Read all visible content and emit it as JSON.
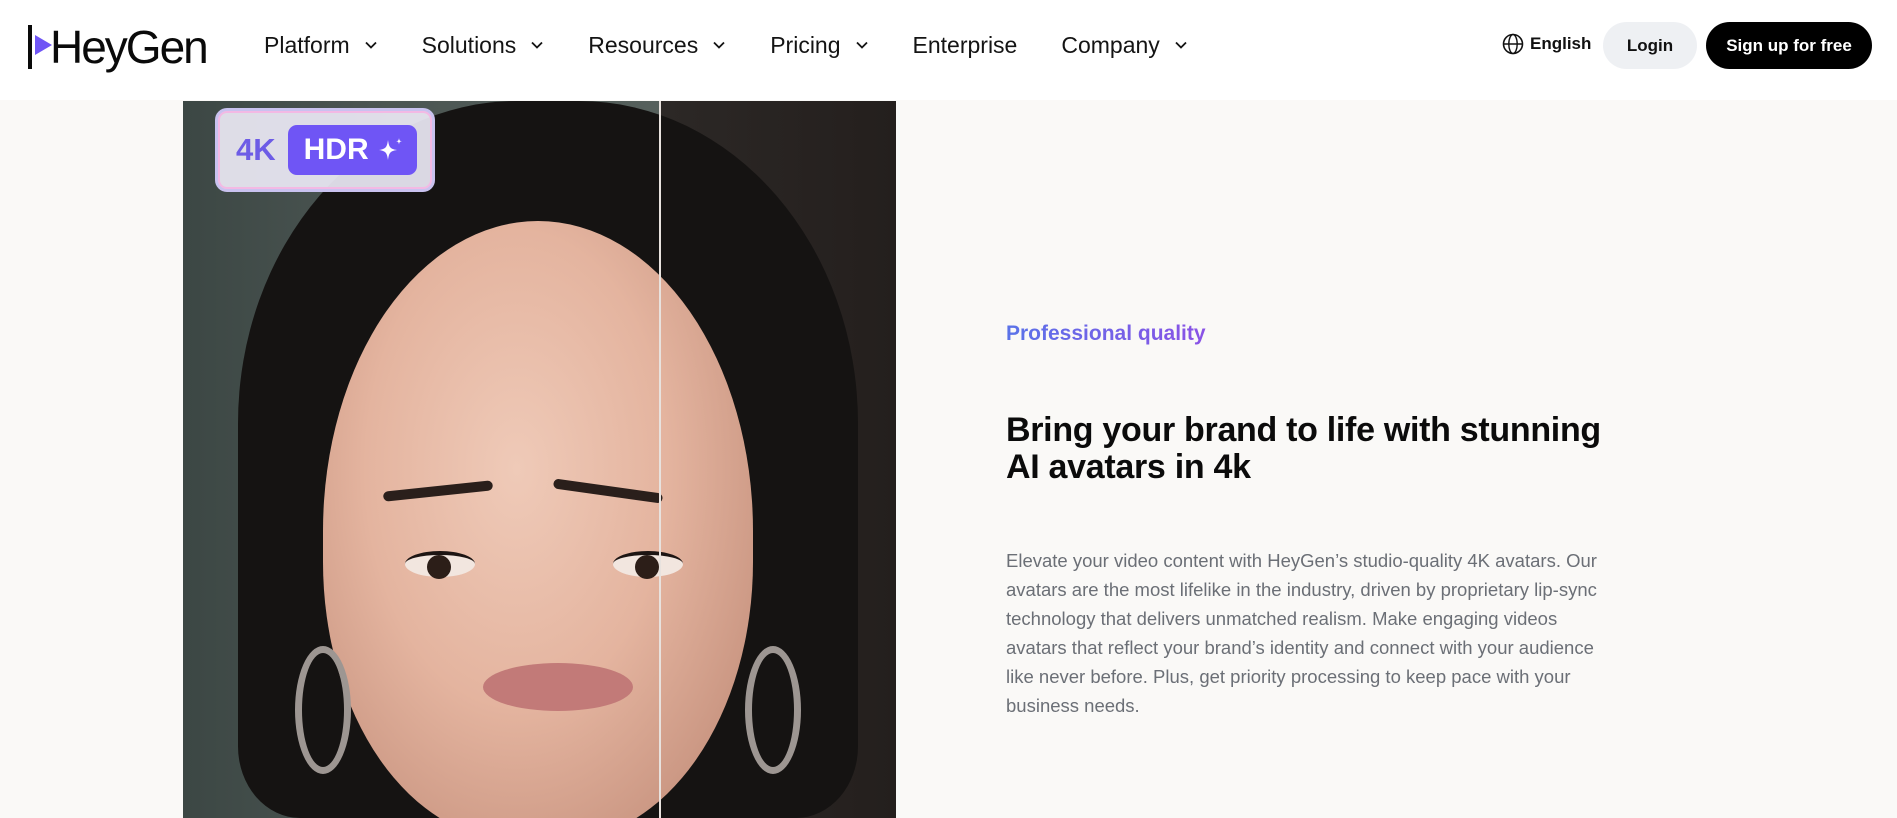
{
  "header": {
    "logo_text": "HeyGen",
    "nav": [
      {
        "label": "Platform",
        "has_dropdown": true
      },
      {
        "label": "Solutions",
        "has_dropdown": true
      },
      {
        "label": "Resources",
        "has_dropdown": true
      },
      {
        "label": "Pricing",
        "has_dropdown": true
      },
      {
        "label": "Enterprise",
        "has_dropdown": false
      },
      {
        "label": "Company",
        "has_dropdown": true
      }
    ],
    "language": "English",
    "login_label": "Login",
    "signup_label": "Sign up for free"
  },
  "hero_image": {
    "badge_resolution": "4K",
    "badge_hdr": "HDR",
    "icons": [
      "sparkle-icon"
    ]
  },
  "section": {
    "eyebrow": "Professional quality",
    "headline": "Bring your brand to life with stunning AI avatars in 4k",
    "body": "Elevate your video content with HeyGen’s studio-quality 4K avatars. Our avatars are the most lifelike in the industry, driven by proprietary lip-sync technology that delivers unmatched realism. Make engaging videos avatars that reflect your brand’s identity and connect with your audience like never before. Plus, get priority processing to keep pace with your business needs."
  },
  "colors": {
    "accent": "#6f55f5",
    "eyebrow_gradient_start": "#5a73e8",
    "eyebrow_gradient_end": "#8a52e6",
    "signup_bg": "#000000",
    "login_bg": "#eef0f3",
    "page_bg": "#faf9f7"
  }
}
